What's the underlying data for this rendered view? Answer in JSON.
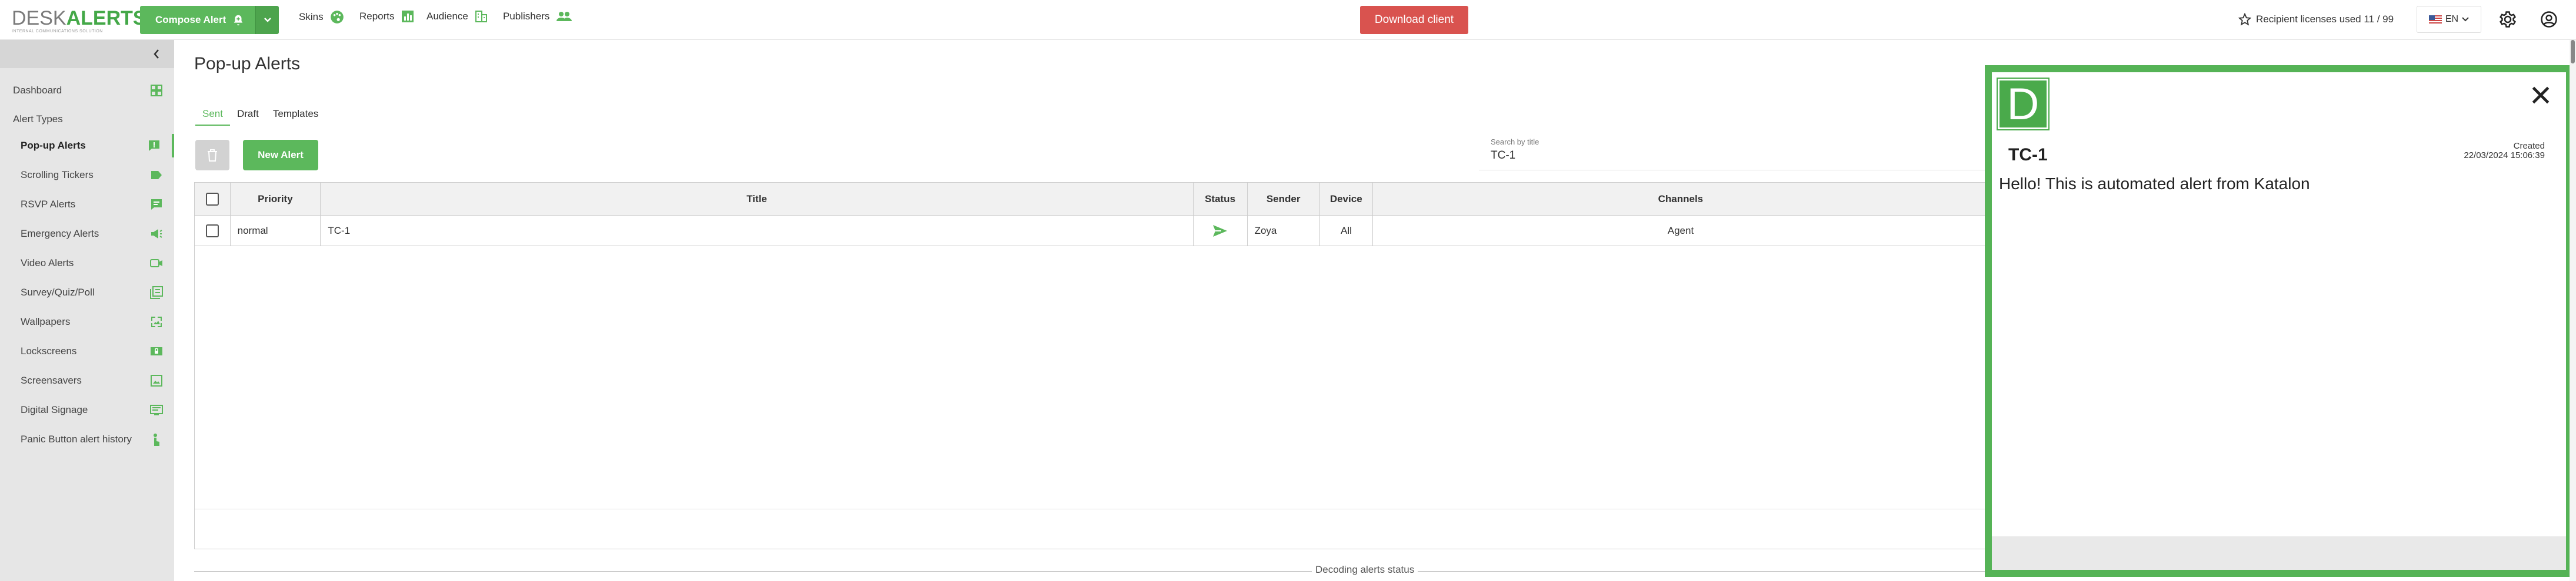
{
  "header": {
    "logo": {
      "part1": "DESK",
      "part2": "ALERTS",
      "tagline": "INTERNAL COMMUNICATIONS SOLUTION"
    },
    "compose_label": "Compose Alert",
    "nav": {
      "skins": "Skins",
      "reports": "Reports",
      "audience": "Audience",
      "publishers": "Publishers"
    },
    "download_label": "Download client",
    "licenses_text": "Recipient licenses used 11 / 99",
    "language": "EN"
  },
  "sidebar": {
    "dashboard": "Dashboard",
    "section_title": "Alert Types",
    "items": [
      {
        "label": "Pop-up Alerts",
        "icon": "popup-icon",
        "active": true
      },
      {
        "label": "Scrolling Tickers",
        "icon": "ticker-icon"
      },
      {
        "label": "RSVP Alerts",
        "icon": "rsvp-icon"
      },
      {
        "label": "Emergency Alerts",
        "icon": "megaphone-icon"
      },
      {
        "label": "Video Alerts",
        "icon": "video-icon"
      },
      {
        "label": "Survey/Quiz/Poll",
        "icon": "survey-icon"
      },
      {
        "label": "Wallpapers",
        "icon": "wallpaper-icon"
      },
      {
        "label": "Lockscreens",
        "icon": "lockscreen-icon"
      },
      {
        "label": "Screensavers",
        "icon": "screensaver-icon"
      },
      {
        "label": "Digital Signage",
        "icon": "signage-icon"
      },
      {
        "label": "Panic Button alert history",
        "icon": "panic-icon"
      }
    ]
  },
  "main": {
    "title": "Pop-up Alerts",
    "tabs": [
      "Sent",
      "Draft",
      "Templates"
    ],
    "new_alert_label": "New Alert",
    "search": {
      "label": "Search by title",
      "value": "TC-1"
    },
    "table": {
      "headers": {
        "priority": "Priority",
        "title": "Title",
        "status": "Status",
        "sender": "Sender",
        "device": "Device",
        "channels": "Channels"
      },
      "rows": [
        {
          "priority": "normal",
          "title": "TC-1",
          "sender": "Zoya",
          "device": "All",
          "channels": "Agent"
        }
      ]
    },
    "decoding_label": "Decoding alerts status"
  },
  "popup": {
    "logo_letter": "D",
    "title": "TC-1",
    "created_label": "Created",
    "created_date": "22/03/2024 15:06:39",
    "body": "Hello! This is automated alert from Katalon"
  },
  "colors": {
    "accent": "#5cb85c",
    "danger": "#d9534f",
    "popup_border": "#55b356"
  }
}
